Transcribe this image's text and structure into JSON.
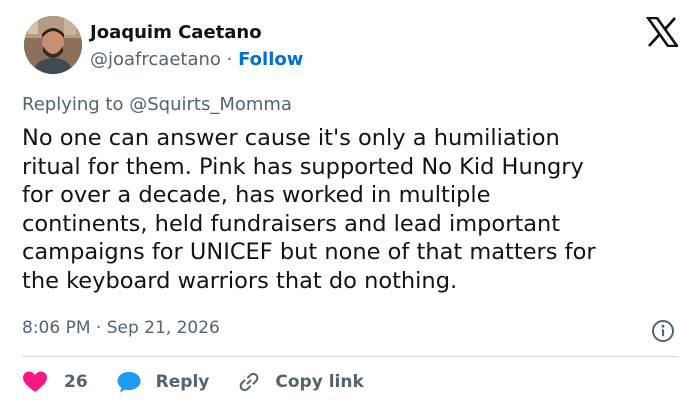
{
  "author": {
    "name": "Joaquim Caetano",
    "handle": "@joafrcaetano",
    "separator": "·",
    "follow_label": "Follow"
  },
  "reply_to": {
    "prefix": "Replying to",
    "mention": "@Squirts_Momma"
  },
  "tweet": {
    "lines": [
      "No one can answer cause it's only a humiliation",
      "ritual for them. Pink has supported No Kid Hungry",
      "for over a decade, has worked in multiple",
      "continents, held fundraisers and lead important",
      "campaigns for UNICEF but none of that matters for",
      "the keyboard warriors that do nothing."
    ],
    "timestamp": "8:06 PM · Sep 21, 2026"
  },
  "actions": {
    "like_count": "26",
    "reply_label": "Reply",
    "copy_link_label": "Copy link"
  },
  "icons": {
    "brand": "x-logo-icon",
    "info": "info-icon",
    "like": "heart-icon",
    "reply": "speech-bubble-icon",
    "copy": "link-icon"
  },
  "colors": {
    "text": "#0f1419",
    "secondary": "#536471",
    "follow": "#006fd6",
    "heart": "#f91880",
    "reply_bubble": "#1d9bf0",
    "divider": "#cfd9de"
  }
}
